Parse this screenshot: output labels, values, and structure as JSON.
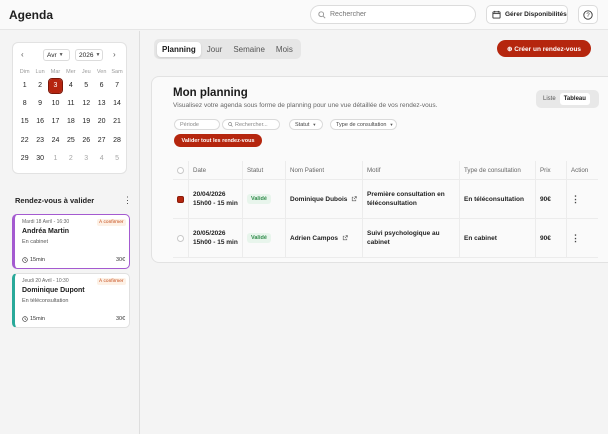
{
  "header": {
    "title": "Agenda",
    "search_placeholder": "Rechercher",
    "dispo_label": "Gérer Disponibilités",
    "help_symbol": "?"
  },
  "calendar": {
    "month": "Avr",
    "year": "2026",
    "prev": "‹",
    "next": "›",
    "weekdays": [
      "Dim",
      "Lun",
      "Mar",
      "Mer",
      "Jeu",
      "Ven",
      "Sam"
    ],
    "weeks": [
      [
        "1",
        "2",
        "3",
        "4",
        "5",
        "6",
        "7"
      ],
      [
        "8",
        "9",
        "10",
        "11",
        "12",
        "13",
        "14"
      ],
      [
        "15",
        "16",
        "17",
        "18",
        "19",
        "20",
        "21"
      ],
      [
        "22",
        "23",
        "24",
        "25",
        "26",
        "27",
        "28"
      ],
      [
        "29",
        "30",
        "1",
        "2",
        "3",
        "4",
        "5"
      ]
    ],
    "selected_day": "3",
    "other_month_from_week5": 2
  },
  "sidebar": {
    "pending_title": "Rendez-vous à valider",
    "more_symbol": "⋮",
    "cards": [
      {
        "date": "Mardi 18 Avril - 16:30",
        "tag": "À confirmer",
        "name": "Andréa Martin",
        "place": "En cabinet",
        "duration": "15min",
        "price": "30€"
      },
      {
        "date": "Jeudi 20 Avril - 10:30",
        "tag": "À confirmer",
        "name": "Dominique Dupont",
        "place": "En téléconsultation",
        "duration": "15min",
        "price": "30€"
      }
    ]
  },
  "views": {
    "tabs": [
      "Planning",
      "Jour",
      "Semaine",
      "Mois"
    ],
    "active": "Planning",
    "create_label": "⊕ Créer un rendez-vous"
  },
  "panel": {
    "title": "Mon planning",
    "subtitle": "Visualisez votre agenda sous forme de planning pour une vue détaillée de vos rendez-vous.",
    "toggle": [
      "Liste",
      "Tableau"
    ],
    "toggle_active": "Tableau",
    "filters": {
      "periode_placeholder": "Période",
      "search_placeholder": "Rechercher...",
      "statut": "Statut",
      "type": "Type de consultation"
    },
    "validate_all_label": "Valider tout les rendez-vous"
  },
  "table": {
    "headers": {
      "date": "Date",
      "statut": "Statut",
      "patient": "Nom Patient",
      "motif": "Motif",
      "type": "Type de consultation",
      "prix": "Prix",
      "action": "Action"
    },
    "rows": [
      {
        "checked": true,
        "date": "20/04/2026",
        "time": "15h00 - 15 min",
        "statut": "Validé",
        "patient": "Dominique Dubois",
        "motif": "Première consultation en téléconsultation",
        "type": "En téléconsultation",
        "prix": "90€",
        "action": "⋮"
      },
      {
        "checked": false,
        "date": "20/05/2026",
        "time": "15h00 - 15 min",
        "statut": "Validé",
        "patient": "Adrien Campos",
        "motif": "Suivi psychologique au cabinet",
        "type": "En cabinet",
        "prix": "90€",
        "action": "⋮"
      }
    ]
  },
  "colors": {
    "brand": "#b5260e",
    "card1_accent": "#a45ad0",
    "card2_accent": "#2aa99a",
    "status_green": "#2f8a4a"
  },
  "icons": {
    "search": "search-icon",
    "calendar": "calendar-icon",
    "help": "help-icon",
    "clock": "clock-icon",
    "external": "external-link-icon"
  }
}
